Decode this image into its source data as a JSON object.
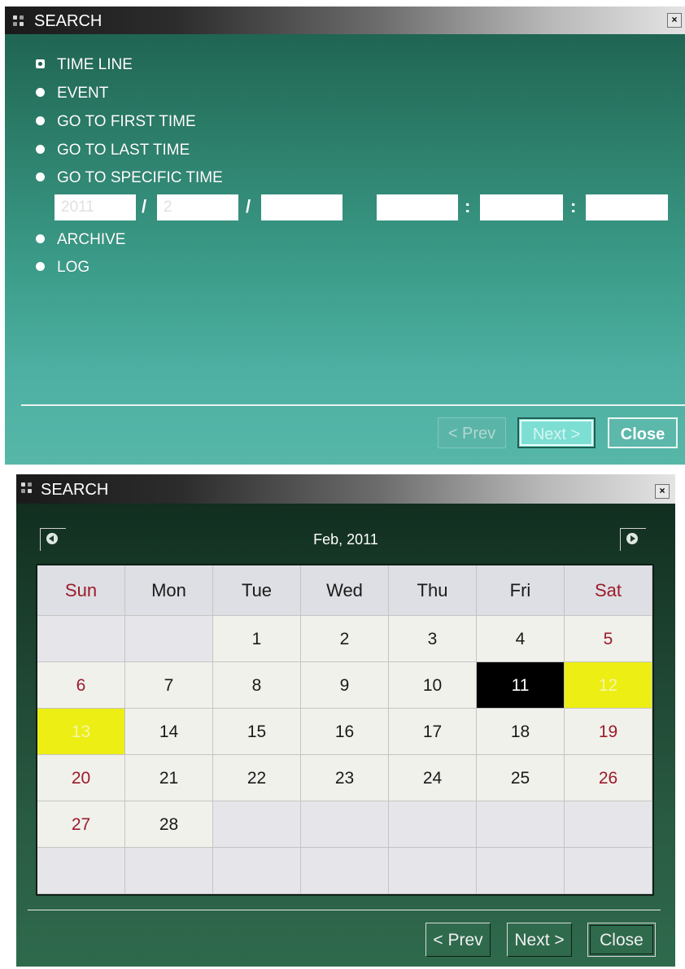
{
  "window1": {
    "title": "SEARCH",
    "close_label": "×",
    "options": [
      {
        "label": "TIME LINE",
        "selected": true
      },
      {
        "label": "EVENT",
        "selected": false
      },
      {
        "label": "GO TO FIRST TIME",
        "selected": false
      },
      {
        "label": "GO TO LAST TIME",
        "selected": false
      },
      {
        "label": "GO TO SPECIFIC TIME",
        "selected": false
      },
      {
        "label": "ARCHIVE",
        "selected": false
      },
      {
        "label": "LOG",
        "selected": false
      }
    ],
    "specific_time": {
      "year": "2011",
      "month": "2",
      "day": "",
      "hour": "",
      "minute": "",
      "second": "",
      "date_separator": "/",
      "time_separator": ":"
    },
    "buttons": {
      "prev": "< Prev",
      "next": "Next >",
      "close": "Close"
    }
  },
  "window2": {
    "title": "SEARCH",
    "close_label": "×",
    "month_label": "Feb, 2011",
    "weekdays": [
      "Sun",
      "Mon",
      "Tue",
      "Wed",
      "Thu",
      "Fri",
      "Sat"
    ],
    "weeks": [
      [
        "",
        "",
        "1",
        "2",
        "3",
        "4",
        "5"
      ],
      [
        "6",
        "7",
        "8",
        "9",
        "10",
        "11",
        "12"
      ],
      [
        "13",
        "14",
        "15",
        "16",
        "17",
        "18",
        "19"
      ],
      [
        "20",
        "21",
        "22",
        "23",
        "24",
        "25",
        "26"
      ],
      [
        "27",
        "28",
        "",
        "",
        "",
        "",
        ""
      ],
      [
        "",
        "",
        "",
        "",
        "",
        "",
        ""
      ]
    ],
    "selected_day": "11",
    "highlighted_days": [
      "12",
      "13"
    ],
    "buttons": {
      "prev": "< Prev",
      "next": "Next >",
      "close": "Close"
    }
  },
  "colors": {
    "weekend_text": "#9b1b2a",
    "selected_day_bg": "#000000",
    "highlight_day_bg": "#ecee14"
  }
}
